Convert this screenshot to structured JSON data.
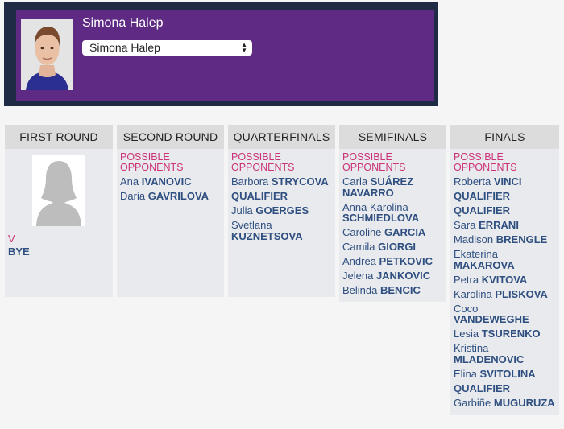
{
  "header": {
    "player_name": "Simona Halep",
    "select_value": "Simona Halep",
    "accent_color": "#5e2a84",
    "frame_color": "#1f2a44"
  },
  "rounds": [
    {
      "title": "FIRST ROUND",
      "versus": "V",
      "opponent": "BYE"
    },
    {
      "title": "SECOND ROUND",
      "possible_label": "POSSIBLE OPPONENTS",
      "opponents": [
        {
          "first": "Ana",
          "last": "IVANOVIC"
        },
        {
          "first": "Daria",
          "last": "GAVRILOVA"
        }
      ]
    },
    {
      "title": "QUARTERFINALS",
      "possible_label": "POSSIBLE OPPONENTS",
      "opponents": [
        {
          "first": "Barbora",
          "last": "STRYCOVA"
        },
        {
          "first": "",
          "last": "QUALIFIER"
        },
        {
          "first": "Julia",
          "last": "GOERGES"
        },
        {
          "first": "Svetlana",
          "last": "KUZNETSOVA"
        }
      ]
    },
    {
      "title": "SEMIFINALS",
      "possible_label": "POSSIBLE OPPONENTS",
      "opponents": [
        {
          "first": "Carla",
          "last": "SUÁREZ NAVARRO"
        },
        {
          "first": "Anna Karolina",
          "last": "SCHMIEDLOVA"
        },
        {
          "first": "Caroline",
          "last": "GARCIA"
        },
        {
          "first": "Camila",
          "last": "GIORGI"
        },
        {
          "first": "Andrea",
          "last": "PETKOVIC"
        },
        {
          "first": "Jelena",
          "last": "JANKOVIC"
        },
        {
          "first": "Belinda",
          "last": "BENCIC"
        }
      ]
    },
    {
      "title": "FINALS",
      "possible_label": "POSSIBLE OPPONENTS",
      "opponents": [
        {
          "first": "Roberta",
          "last": "VINCI"
        },
        {
          "first": "",
          "last": "QUALIFIER"
        },
        {
          "first": "",
          "last": "QUALIFIER"
        },
        {
          "first": "Sara",
          "last": "ERRANI"
        },
        {
          "first": "Madison",
          "last": "BRENGLE"
        },
        {
          "first": "Ekaterina",
          "last": "MAKAROVA"
        },
        {
          "first": "Petra",
          "last": "KVITOVA"
        },
        {
          "first": "Karolina",
          "last": "PLISKOVA"
        },
        {
          "first": "Coco",
          "last": "VANDEWEGHE"
        },
        {
          "first": "Lesia",
          "last": "TSURENKO"
        },
        {
          "first": "Kristina",
          "last": "MLADENOVIC"
        },
        {
          "first": "Elina",
          "last": "SVITOLINA"
        },
        {
          "first": "",
          "last": "QUALIFIER"
        },
        {
          "first": "Garbiñe",
          "last": "MUGURUZA"
        }
      ]
    }
  ]
}
